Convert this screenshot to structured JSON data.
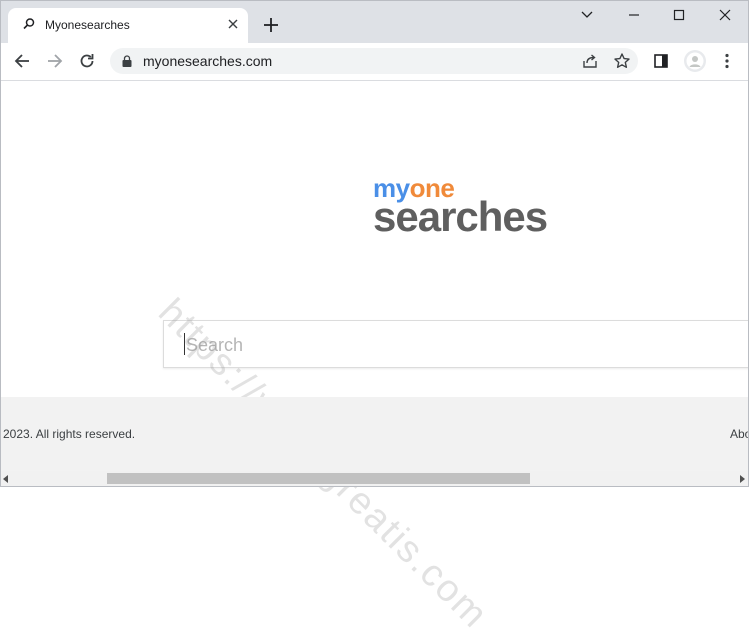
{
  "browser": {
    "tab": {
      "title": "Myonesearches"
    },
    "omnibox": {
      "url": "myonesearches.com"
    },
    "icons": [
      "search-favicon-icon",
      "close-icon",
      "plus-icon",
      "chevron-down-icon",
      "minimize-icon",
      "maximize-icon",
      "close-window-icon",
      "back-arrow-icon",
      "forward-arrow-icon",
      "reload-icon",
      "lock-icon",
      "share-icon",
      "star-icon",
      "sidebar-icon",
      "avatar-icon",
      "kebab-menu-icon"
    ]
  },
  "page": {
    "logo": {
      "part1": "my",
      "part2": "one",
      "part3": "searches"
    },
    "search": {
      "placeholder": "Search",
      "value": ""
    },
    "watermark": "https://www.greatis.com",
    "footer": {
      "copyright": "2023. All rights reserved.",
      "link": "Abo"
    }
  },
  "colors": {
    "logo_blue": "#4a8fe7",
    "logo_orange": "#f08a3a",
    "logo_gray": "#5f5f5f"
  }
}
